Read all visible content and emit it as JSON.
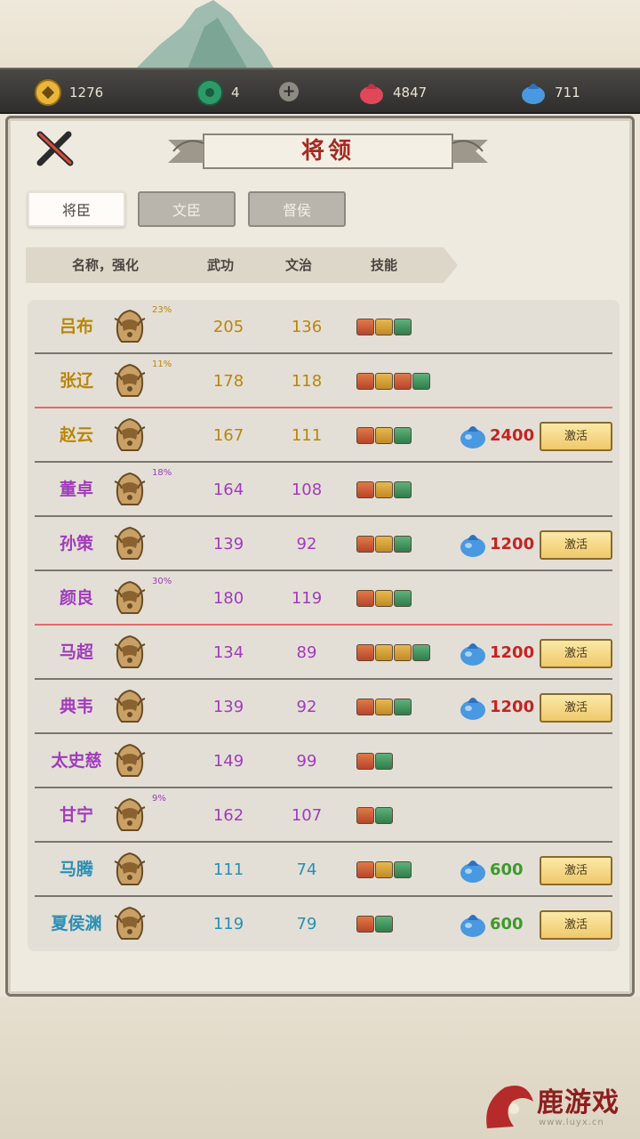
{
  "resources": {
    "coin": "1276",
    "jade": "4",
    "red_essence": "4847",
    "blue_essence": "711"
  },
  "title": "将领",
  "tabs": [
    {
      "label": "将臣",
      "active": true
    },
    {
      "label": "文臣",
      "active": false
    },
    {
      "label": "督侯",
      "active": false
    }
  ],
  "columns": {
    "name": "名称，强化",
    "wu": "武功",
    "wen": "文治",
    "skill": "技能"
  },
  "activate_label": "激活",
  "colors": {
    "gold": "#b8860b",
    "purple": "#a13bbd",
    "blue": "#2a8fb5",
    "cost_red": "#c42323",
    "cost_green": "#3c9a2c"
  },
  "generals": [
    {
      "name": "吕布",
      "tier": "gold",
      "pct": "23%",
      "wu": "205",
      "wen": "136",
      "skills": [
        "r",
        "y",
        "g"
      ],
      "cost": "",
      "divider": "gray"
    },
    {
      "name": "张辽",
      "tier": "gold",
      "pct": "11%",
      "wu": "178",
      "wen": "118",
      "skills": [
        "r",
        "y",
        "r",
        "g"
      ],
      "cost": "",
      "divider": "red"
    },
    {
      "name": "赵云",
      "tier": "gold",
      "pct": "",
      "wu": "167",
      "wen": "111",
      "skills": [
        "r",
        "y",
        "g"
      ],
      "cost": "2400",
      "divider": "gray"
    },
    {
      "name": "董卓",
      "tier": "purple",
      "pct": "18%",
      "wu": "164",
      "wen": "108",
      "skills": [
        "r",
        "y",
        "g"
      ],
      "cost": "",
      "divider": "gray"
    },
    {
      "name": "孙策",
      "tier": "purple",
      "pct": "",
      "wu": "139",
      "wen": "92",
      "skills": [
        "r",
        "y",
        "g"
      ],
      "cost": "1200",
      "divider": "gray"
    },
    {
      "name": "颜良",
      "tier": "purple",
      "pct": "30%",
      "wu": "180",
      "wen": "119",
      "skills": [
        "r",
        "y",
        "g"
      ],
      "cost": "",
      "divider": "red"
    },
    {
      "name": "马超",
      "tier": "purple",
      "pct": "",
      "wu": "134",
      "wen": "89",
      "skills": [
        "r",
        "y",
        "y",
        "g"
      ],
      "cost": "1200",
      "divider": "gray"
    },
    {
      "name": "典韦",
      "tier": "purple",
      "pct": "",
      "wu": "139",
      "wen": "92",
      "skills": [
        "r",
        "y",
        "g"
      ],
      "cost": "1200",
      "divider": "gray"
    },
    {
      "name": "太史慈",
      "tier": "purple",
      "pct": "",
      "wu": "149",
      "wen": "99",
      "skills": [
        "r",
        "g"
      ],
      "cost": "",
      "divider": "gray"
    },
    {
      "name": "甘宁",
      "tier": "purple",
      "pct": "9%",
      "wu": "162",
      "wen": "107",
      "skills": [
        "r",
        "g"
      ],
      "cost": "",
      "divider": "gray"
    },
    {
      "name": "马腾",
      "tier": "blue",
      "pct": "",
      "wu": "111",
      "wen": "74",
      "skills": [
        "r",
        "y",
        "g"
      ],
      "cost": "600",
      "divider": "gray"
    },
    {
      "name": "夏侯渊",
      "tier": "blue",
      "pct": "",
      "wu": "119",
      "wen": "79",
      "skills": [
        "r",
        "g"
      ],
      "cost": "600",
      "divider": "none"
    }
  ],
  "watermark": {
    "text": "鹿游戏",
    "url": "www.luyx.cn"
  }
}
